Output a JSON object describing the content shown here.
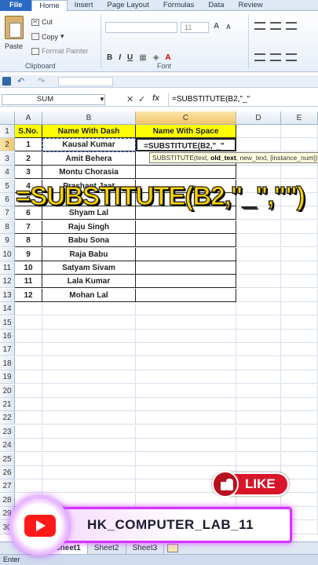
{
  "ribbon": {
    "tabs": [
      "File",
      "Home",
      "Insert",
      "Page Layout",
      "Formulas",
      "Data",
      "Review"
    ],
    "active_tab": "Home",
    "clipboard": {
      "paste": "Paste",
      "cut": "Cut",
      "copy": "Copy",
      "format_painter": "Format Painter",
      "label": "Clipboard"
    },
    "font": {
      "size": "11",
      "label": "Font",
      "bold": "B",
      "italic": "I",
      "underline": "U"
    }
  },
  "formula_bar": {
    "name_box": "SUM",
    "formula": "=SUBSTITUTE(B2,\"_\"",
    "fx": "fx"
  },
  "grid": {
    "columns": [
      "A",
      "B",
      "C",
      "D",
      "E"
    ],
    "row_numbers": [
      "1",
      "2",
      "3",
      "4",
      "5",
      "6",
      "7",
      "8",
      "9",
      "10",
      "11",
      "12",
      "13",
      "14",
      "15",
      "16",
      "17",
      "18",
      "19",
      "20",
      "21",
      "22",
      "23",
      "24",
      "25",
      "26",
      "27",
      "28",
      "29",
      "30"
    ],
    "headers": {
      "sno": "S.No.",
      "dash": "Name With Dash",
      "space": "Name With Space"
    },
    "rows": [
      {
        "sno": "1",
        "name": "Kausal Kumar"
      },
      {
        "sno": "2",
        "name": "Amit Behera"
      },
      {
        "sno": "3",
        "name": "Montu Chorasia"
      },
      {
        "sno": "4",
        "name": "Prashant Jaat"
      },
      {
        "sno": "5",
        "name": ""
      },
      {
        "sno": "6",
        "name": "Shyam Lal"
      },
      {
        "sno": "7",
        "name": "Raju Singh"
      },
      {
        "sno": "8",
        "name": "Babu Sona"
      },
      {
        "sno": "9",
        "name": "Raja Babu"
      },
      {
        "sno": "10",
        "name": "Satyam Sivam"
      },
      {
        "sno": "11",
        "name": "Lala Kumar"
      },
      {
        "sno": "12",
        "name": "Mohan Lal"
      }
    ],
    "active_cell_text": "=SUBSTITUTE(B2,\"_\"",
    "tooltip": {
      "func": "SUBSTITUTE(text, ",
      "bold": "old_text",
      "rest": ", new_text, [instance_num])"
    }
  },
  "overlay": {
    "text": "=SUBSTITUTE(B2,\"_\",\"\")"
  },
  "like": {
    "label": "LIKE"
  },
  "banner": {
    "channel": "HK_COMPUTER_LAB_11"
  },
  "sheets": {
    "tabs": [
      "Sheet1",
      "Sheet2",
      "Sheet3"
    ],
    "active": "Sheet1"
  },
  "status": {
    "text": "Enter"
  },
  "colors": {
    "header_fill": "#ffff00",
    "overlay_text": "#ffd400",
    "like_red": "#d9152a",
    "banner_border": "#d633ff"
  }
}
